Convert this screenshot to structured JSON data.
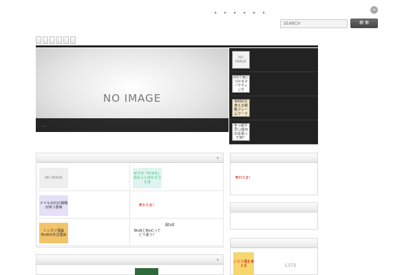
{
  "header": {
    "site_title": "",
    "site_description": "",
    "rss_icon": "rss-icon"
  },
  "topnav": [
    {
      "label": ""
    },
    {
      "label": ""
    },
    {
      "label": ""
    },
    {
      "label": ""
    },
    {
      "label": ""
    },
    {
      "label": ""
    }
  ],
  "search": {
    "placeholder": "SEARCH",
    "button_label": "検 索"
  },
  "tabs": [
    {
      "label": ""
    },
    {
      "label": ""
    },
    {
      "label": ""
    },
    {
      "label": ""
    },
    {
      "label": ""
    },
    {
      "label": ""
    }
  ],
  "hero": {
    "placeholder": "NO IMAGE",
    "caption": "",
    "caption_more": "..."
  },
  "slider": [
    {
      "thumb": "NO IMAGE",
      "meta": "",
      "title": ""
    },
    {
      "thumb": "0円で身につけるマーケティング",
      "meta": "",
      "title": ""
    },
    {
      "thumb": "BASICS 使える戦略フレームワーク",
      "meta": "",
      "title": ""
    },
    {
      "thumb": "手っ取り早い成功の近道って何？",
      "meta": "",
      "title": ""
    }
  ],
  "new_posts": {
    "heading": "",
    "more": "",
    "items": [
      {
        "thumb": "NO IMAGE",
        "title": ""
      },
      {
        "thumb": "ゼブラ「サラサ」のヒットのヒミツとは",
        "title": ""
      },
      {
        "thumb": "ナイキのD2C戦略が持つ意味",
        "title": ""
      },
      {
        "thumb": "売れたま！",
        "title": ""
      },
      {
        "thumb": "トンカツ理論 BtoBの外注理由",
        "title": ""
      },
      {
        "thumb": "BtoBとBtoCってどう違う？",
        "title": "Btoll"
      }
    ]
  },
  "second_section": {
    "heading": "",
    "more": ""
  },
  "sidebar": {
    "box1": {
      "heading": "",
      "thumb": "売れたま！",
      "text": ""
    },
    "box2": {
      "heading": "",
      "text": ""
    },
    "box3": {
      "heading": "",
      "thumb": "シミリ理を考える",
      "text": "",
      "count": "1,572"
    }
  },
  "colors": {
    "accent": "#2e84c8",
    "dark": "#222222"
  }
}
